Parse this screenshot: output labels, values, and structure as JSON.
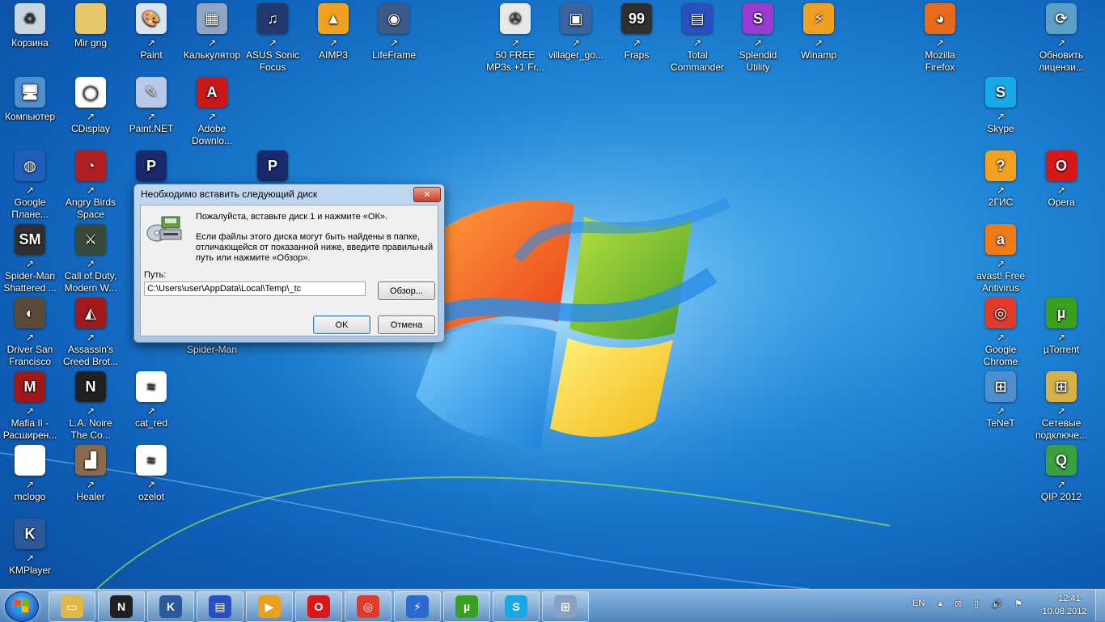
{
  "desktop_icons": [
    {
      "label": "Корзина",
      "icon": "recycle-bin-icon",
      "color": "#c9d6e2",
      "glyph": "♻"
    },
    {
      "label": "Mir gng",
      "icon": "folder-icon",
      "color": "#e8c66a",
      "glyph": ""
    },
    {
      "label": "Paint",
      "icon": "paint-palette-icon",
      "color": "#d9e6f2",
      "glyph": "🎨"
    },
    {
      "label": "Калькулятор",
      "icon": "calculator-icon",
      "color": "#8fa7c4",
      "glyph": "▦"
    },
    {
      "label": "ASUS Sonic Focus",
      "icon": "asus-sonic-icon",
      "color": "#223a6e",
      "glyph": "♫"
    },
    {
      "label": "AIMP3",
      "icon": "aimp-icon",
      "color": "#f2a020",
      "glyph": "▲"
    },
    {
      "label": "LifeFrame",
      "icon": "camera-icon",
      "color": "#3c5a88",
      "glyph": "◉"
    },
    {
      "label": "50 FREE MP3s +1 Fr...",
      "icon": "film-reel-icon",
      "color": "#e8e8e8",
      "glyph": "✇"
    },
    {
      "label": "villager_go...",
      "icon": "image-file-icon",
      "color": "#3a64a0",
      "glyph": "▣"
    },
    {
      "label": "Fraps",
      "icon": "fraps-icon",
      "color": "#303030",
      "glyph": "99"
    },
    {
      "label": "Total Commander",
      "icon": "floppy-disk-icon",
      "color": "#2a4fc0",
      "glyph": "▤"
    },
    {
      "label": "Splendid Utility",
      "icon": "splendid-icon",
      "color": "#9a3ad0",
      "glyph": "S"
    },
    {
      "label": "Winamp",
      "icon": "winamp-icon",
      "color": "#f0a020",
      "glyph": "⚡"
    },
    {
      "label": "Mozilla Firefox",
      "icon": "firefox-icon",
      "color": "#e86a1a",
      "glyph": "◕"
    },
    {
      "label": "Обновить лицензи...",
      "icon": "update-license-icon",
      "color": "#5aa0c8",
      "glyph": "⟳"
    },
    {
      "label": "Компьютер",
      "icon": "computer-icon",
      "color": "#4f8fd0",
      "glyph": "🖥"
    },
    {
      "label": "CDisplay",
      "icon": "speech-bubble-icon",
      "color": "#ffffff",
      "glyph": "◯"
    },
    {
      "label": "Paint.NET",
      "icon": "paint-net-icon",
      "color": "#b8c8e8",
      "glyph": "✎"
    },
    {
      "label": "Adobe Downlo...",
      "icon": "adobe-icon",
      "color": "#c81818",
      "glyph": "A"
    },
    {
      "label": "Skype",
      "icon": "skype-icon",
      "color": "#19a8e6",
      "glyph": "S"
    },
    {
      "label": "Google Плане...",
      "icon": "google-earth-icon",
      "color": "#1f5fb8",
      "glyph": "◍"
    },
    {
      "label": "Angry Birds Space",
      "icon": "angry-birds-icon",
      "color": "#b02020",
      "glyph": "◔"
    },
    {
      "label": "",
      "icon": "pes-game-icon",
      "color": "#1a2a6a",
      "glyph": "P"
    },
    {
      "label": "",
      "icon": "pes-game-2-icon",
      "color": "#1a2a6a",
      "glyph": "P"
    },
    {
      "label": "2ГИС",
      "icon": "2gis-icon",
      "color": "#f2a020",
      "glyph": "?"
    },
    {
      "label": "Opera",
      "icon": "opera-icon",
      "color": "#d81818",
      "glyph": "O"
    },
    {
      "label": "Spider-Man Shattered ...",
      "icon": "spiderman-icon",
      "color": "#303030",
      "glyph": "SM"
    },
    {
      "label": "Call of Duty, Modern W...",
      "icon": "cod-icon",
      "color": "#3a4a3a",
      "glyph": "⚔"
    },
    {
      "label": "avast! Free Antivirus",
      "icon": "avast-icon",
      "color": "#f07a18",
      "glyph": "a"
    },
    {
      "label": "Driver San Francisco",
      "icon": "driver-game-icon",
      "color": "#5a4a3a",
      "glyph": "◐"
    },
    {
      "label": "Assassin's Creed Brot...",
      "icon": "assassins-creed-icon",
      "color": "#a01a1a",
      "glyph": "◭"
    },
    {
      "label": "Spider-Man",
      "icon": "spiderman-2-icon",
      "color": "#303030",
      "glyph": "SM"
    },
    {
      "label": "Google Chrome",
      "icon": "chrome-icon",
      "color": "#e03a2a",
      "glyph": "◎"
    },
    {
      "label": "µTorrent",
      "icon": "utorrent-icon",
      "color": "#3aa020",
      "glyph": "µ"
    },
    {
      "label": "Mafia II - Расширен...",
      "icon": "mafia-icon",
      "color": "#a01818",
      "glyph": "M"
    },
    {
      "label": "L.A. Noire The Co...",
      "icon": "la-noire-icon",
      "color": "#202020",
      "glyph": "N"
    },
    {
      "label": "cat_red",
      "icon": "image-file-icon",
      "color": "#ffffff",
      "glyph": "≈"
    },
    {
      "label": "TeNeT",
      "icon": "network-computers-icon",
      "color": "#4f8fd0",
      "glyph": "⊞"
    },
    {
      "label": "Сетевые подключе...",
      "icon": "network-connections-icon",
      "color": "#d8b048",
      "glyph": "⊞"
    },
    {
      "label": "mclogo",
      "icon": "blank-image-icon",
      "color": "#ffffff",
      "glyph": ""
    },
    {
      "label": "Healer",
      "icon": "healer-image-icon",
      "color": "#8a6a4a",
      "glyph": "▟"
    },
    {
      "label": "ozelot",
      "icon": "image-file-icon",
      "color": "#ffffff",
      "glyph": "≈"
    },
    {
      "label": "QIP 2012",
      "icon": "qip-icon",
      "color": "#3aa040",
      "glyph": "Q"
    },
    {
      "label": "KMPlayer",
      "icon": "kmplayer-icon",
      "color": "#2a5a9a",
      "glyph": "K"
    }
  ],
  "dialog": {
    "title": "Необходимо вставить следующий диск",
    "close_glyph": "✕",
    "message_1": "Пожалуйста, вставьте диск 1 и нажмите «ОК».",
    "message_2": "Если файлы этого диска могут быть найдены в папке, отличающейся от показанной ниже, введите правильный путь или нажмите «Обзор».",
    "path_label": "Путь:",
    "path_value": "C:\\Users\\user\\AppData\\Local\\Temp\\_tc",
    "browse_label": "Обзор...",
    "ok_label": "OK",
    "cancel_label": "Отмена"
  },
  "taskbar": {
    "pinned": [
      {
        "icon": "explorer-folder-icon",
        "color": "#e0b84a",
        "glyph": "▭"
      },
      {
        "icon": "la-noire-icon",
        "color": "#202020",
        "glyph": "N"
      },
      {
        "icon": "kmplayer-icon",
        "color": "#2a5a9a",
        "glyph": "K"
      },
      {
        "icon": "floppy-disk-icon",
        "color": "#2a4fc0",
        "glyph": "▤"
      },
      {
        "icon": "media-player-icon",
        "color": "#e8a020",
        "glyph": "▶"
      },
      {
        "icon": "opera-icon",
        "color": "#d81818",
        "glyph": "O"
      },
      {
        "icon": "chrome-icon",
        "color": "#e03a2a",
        "glyph": "◎"
      },
      {
        "icon": "lightning-icon",
        "color": "#2a6ad0",
        "glyph": "⚡"
      },
      {
        "icon": "utorrent-icon",
        "color": "#3aa020",
        "glyph": "µ"
      },
      {
        "icon": "skype-icon",
        "color": "#19a8e6",
        "glyph": "S"
      },
      {
        "icon": "installer-icon",
        "color": "#8aa0c0",
        "glyph": "⊞"
      }
    ],
    "language": "EN",
    "time": "12:41",
    "date": "10.08.2012"
  }
}
